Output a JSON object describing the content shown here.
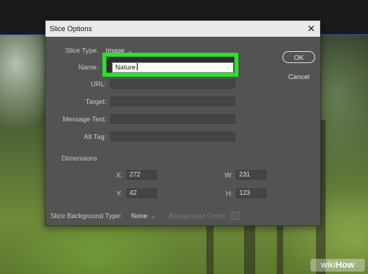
{
  "dialog": {
    "title": "Slice Options",
    "close_glyph": "✕"
  },
  "slice_type": {
    "label": "Slice Type:",
    "value": "Image"
  },
  "fields": {
    "name": {
      "label": "Name:",
      "value": "Nature"
    },
    "url": {
      "label": "URL:",
      "value": ""
    },
    "target": {
      "label": "Target:",
      "value": ""
    },
    "message_text": {
      "label": "Message Text:",
      "value": ""
    },
    "alt_tag": {
      "label": "Alt Tag:",
      "value": ""
    }
  },
  "buttons": {
    "ok": "OK",
    "cancel": "Cancel"
  },
  "dimensions": {
    "heading": "Dimensions",
    "x": {
      "label": "X:",
      "value": "272"
    },
    "y": {
      "label": "Y:",
      "value": "42"
    },
    "w": {
      "label": "W:",
      "value": "231"
    },
    "h": {
      "label": "H:",
      "value": "123"
    }
  },
  "background": {
    "type_label": "Slice Background Type:",
    "type_value": "None",
    "color_label": "Background Color:"
  },
  "watermark": {
    "part1": "wiki",
    "part2": "How"
  },
  "colors": {
    "highlight": "#26e326",
    "dialog_bg": "#535353",
    "titlebar": "#e9e9e9"
  },
  "icons": {
    "close": "close-icon",
    "dropdown": "chevron-down-icon"
  }
}
